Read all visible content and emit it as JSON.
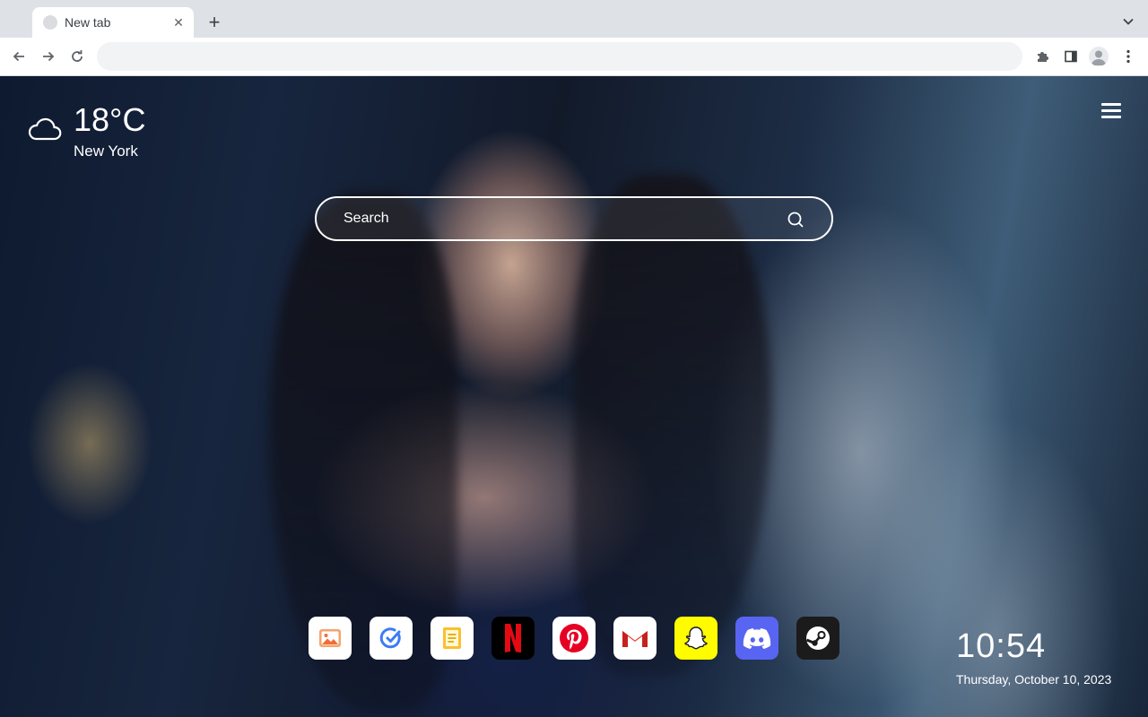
{
  "browser": {
    "tab": {
      "title": "New tab",
      "close_glyph": "✕"
    },
    "new_tab_glyph": "+",
    "omnibox": {
      "value": "",
      "placeholder": ""
    }
  },
  "weather": {
    "temperature": "18°C",
    "city": "New York",
    "icon": "cloud-icon"
  },
  "search": {
    "placeholder": "Search"
  },
  "dock": {
    "apps": [
      {
        "name": "photos",
        "icon": "image-icon",
        "bg": "#ffffff"
      },
      {
        "name": "tasks",
        "icon": "check-circle-icon",
        "bg": "#ffffff"
      },
      {
        "name": "notes",
        "icon": "notes-icon",
        "bg": "#ffffff"
      },
      {
        "name": "netflix",
        "icon": "netflix-icon",
        "bg": "#000000"
      },
      {
        "name": "pinterest",
        "icon": "pinterest-icon",
        "bg": "#ffffff"
      },
      {
        "name": "gmail",
        "icon": "gmail-icon",
        "bg": "#ffffff"
      },
      {
        "name": "snapchat",
        "icon": "snapchat-icon",
        "bg": "#fffc00"
      },
      {
        "name": "discord",
        "icon": "discord-icon",
        "bg": "#5865f2"
      },
      {
        "name": "steam",
        "icon": "steam-icon",
        "bg": "#1b1b1b"
      }
    ]
  },
  "clock": {
    "time": "10:54",
    "date": "Thursday, October 10, 2023"
  },
  "colors": {
    "netflix_red": "#e50914",
    "pinterest_red": "#e60023",
    "gmail_red": "#ea4335",
    "snap_yellow": "#fffc00",
    "discord_blurple": "#5865f2"
  }
}
